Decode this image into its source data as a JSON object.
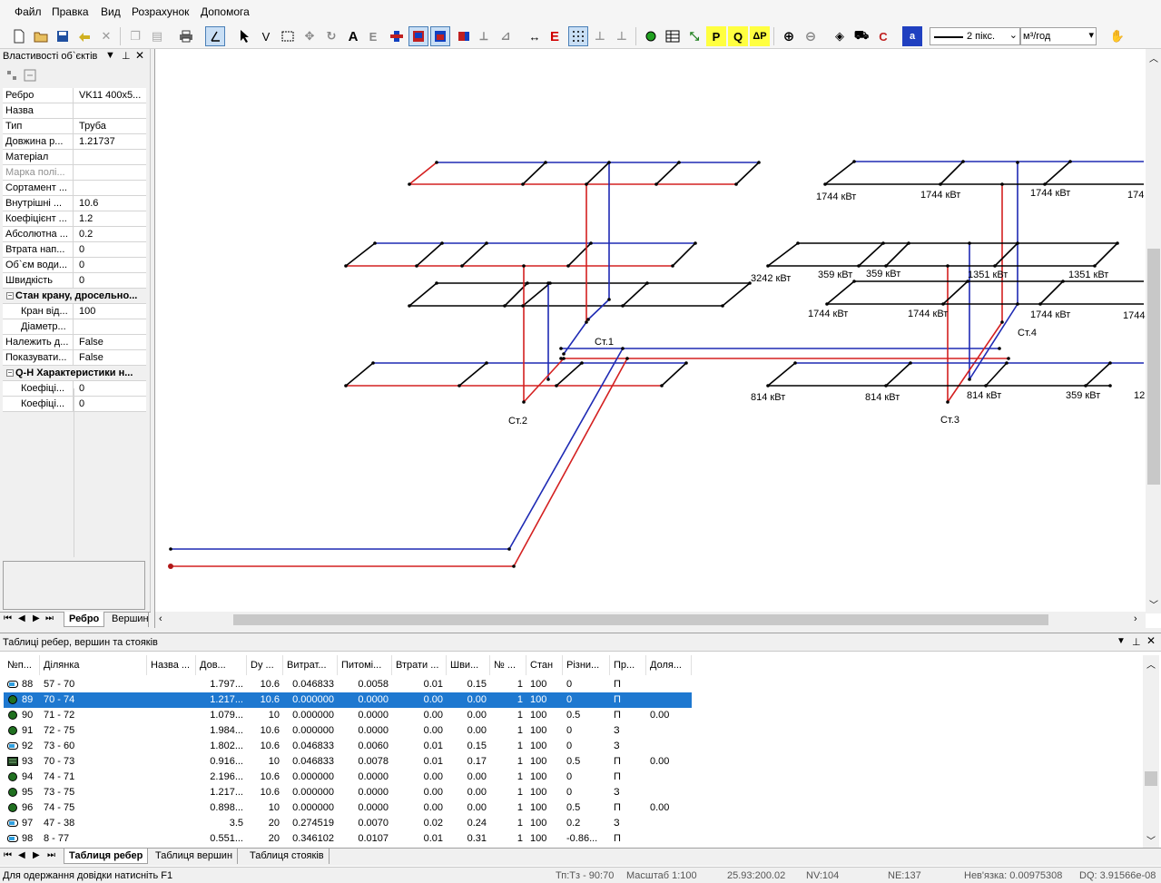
{
  "menu": [
    "Файл",
    "Правка",
    "Вид",
    "Розрахунок",
    "Допомога"
  ],
  "toolbar": {
    "line_width": "2 пікс.",
    "units": "м³/год",
    "icons": [
      "new-icon",
      "open-icon",
      "save-icon",
      "undo-icon",
      "delete-icon",
      "copy-icon",
      "paste-icon",
      "print-icon",
      "angle-icon",
      "pointer-icon",
      "vertex-icon",
      "rect-select-icon",
      "move-icon",
      "rotate-icon",
      "text-icon",
      "text-e-icon",
      "node-icon",
      "node-red-icon",
      "node-blue-icon",
      "node-flag-icon",
      "measure-icon",
      "tilt-icon",
      "dimension-icon",
      "e-icon",
      "grid-icon",
      "sep",
      "sep",
      "green-dot-icon",
      "table-icon",
      "link-icon",
      "p-icon",
      "q-icon",
      "ap-icon",
      "zoom-in-icon",
      "zoom-out-icon",
      "pan-icon",
      "truck-icon",
      "c-icon",
      "a-icon"
    ]
  },
  "properties": {
    "title": "Властивості об`єктів",
    "rows": [
      {
        "k": "Ребро",
        "v": "VK11 400x5..."
      },
      {
        "k": "Назва",
        "v": ""
      },
      {
        "k": "Тип",
        "v": "Труба"
      },
      {
        "k": "Довжина р...",
        "v": "1.21737"
      },
      {
        "k": "Матеріал",
        "v": ""
      },
      {
        "k": "Марка полі...",
        "v": "",
        "disabled": true
      },
      {
        "k": "Сортамент ...",
        "v": ""
      },
      {
        "k": "Внутрішні ...",
        "v": "10.6"
      },
      {
        "k": "Коефіцієнт ...",
        "v": "1.2"
      },
      {
        "k": "Абсолютна ...",
        "v": "0.2"
      },
      {
        "k": "Втрата нап...",
        "v": "0"
      },
      {
        "k": "Об`єм води...",
        "v": "0"
      },
      {
        "k": "Швидкість",
        "v": "0"
      },
      {
        "k": "Стан крану, дросельно...",
        "v": "",
        "group": true
      },
      {
        "k": "Кран від...",
        "v": "100",
        "sub": true
      },
      {
        "k": "Діаметр...",
        "v": "",
        "sub": true
      },
      {
        "k": "Належить д...",
        "v": "False"
      },
      {
        "k": "Показувати...",
        "v": "False"
      },
      {
        "k": "Q-H Характеристики н...",
        "v": "",
        "group": true
      },
      {
        "k": "Коефіці...",
        "v": "0",
        "sub": true
      },
      {
        "k": "Коефіці...",
        "v": "0",
        "sub": true
      }
    ],
    "tabs": [
      "Ребро",
      "Вершин"
    ]
  },
  "canvas": {
    "labels": [
      {
        "t": "1744 кВт"
      },
      {
        "t": "1744 кВт"
      },
      {
        "t": "1744 кВт"
      },
      {
        "t": "174"
      },
      {
        "t": "3242 кВт"
      },
      {
        "t": "359 кВт"
      },
      {
        "t": "359 кВт"
      },
      {
        "t": "1351 кВт"
      },
      {
        "t": "1351 кВт"
      },
      {
        "t": "1744 кВт"
      },
      {
        "t": "1744 кВт"
      },
      {
        "t": "1744 кВт"
      },
      {
        "t": "1744"
      },
      {
        "t": "Ст.1"
      },
      {
        "t": "Ст.4"
      },
      {
        "t": "814 кВт"
      },
      {
        "t": "814 кВт"
      },
      {
        "t": "814 кВт"
      },
      {
        "t": "359 кВт"
      },
      {
        "t": "12"
      },
      {
        "t": "Ст.2"
      },
      {
        "t": "Ст.3"
      }
    ]
  },
  "table": {
    "title": "Таблиці ребер, вершин та стояків",
    "headers": [
      "№п...",
      "Ділянка",
      "Назва ...",
      "Дов...",
      "Dy ...",
      "Витрат...",
      "Питомі...",
      "Втрати ...",
      "Шви...",
      "№ ...",
      "Стан",
      "Різни...",
      "Пр...",
      "Доля..."
    ],
    "rows": [
      {
        "icon": "pipe-blue",
        "n": "88",
        "seg": "57 - 70",
        "name": "",
        "len": "1.797...",
        "dy": "10.6",
        "flow": "0.046833",
        "spec": "0.0058",
        "loss": "0.01",
        "speed": "0.15",
        "num": "1",
        "state": "100",
        "diff": "0",
        "pr": "П",
        "share": ""
      },
      {
        "icon": "valve-green",
        "n": "89",
        "seg": "70 - 74",
        "name": "",
        "len": "1.217...",
        "dy": "10.6",
        "flow": "0.000000",
        "spec": "0.0000",
        "loss": "0.00",
        "speed": "0.00",
        "num": "1",
        "state": "100",
        "diff": "0",
        "pr": "П",
        "share": "",
        "selected": true
      },
      {
        "icon": "valve-green",
        "n": "90",
        "seg": "71 - 72",
        "name": "",
        "len": "1.079...",
        "dy": "10",
        "flow": "0.000000",
        "spec": "0.0000",
        "loss": "0.00",
        "speed": "0.00",
        "num": "1",
        "state": "100",
        "diff": "0.5",
        "pr": "П",
        "share": "0.00"
      },
      {
        "icon": "valve-green",
        "n": "91",
        "seg": "72 - 75",
        "name": "",
        "len": "1.984...",
        "dy": "10.6",
        "flow": "0.000000",
        "spec": "0.0000",
        "loss": "0.00",
        "speed": "0.00",
        "num": "1",
        "state": "100",
        "diff": "0",
        "pr": "З",
        "share": ""
      },
      {
        "icon": "pipe-blue",
        "n": "92",
        "seg": "73 - 60",
        "name": "",
        "len": "1.802...",
        "dy": "10.6",
        "flow": "0.046833",
        "spec": "0.0060",
        "loss": "0.01",
        "speed": "0.15",
        "num": "1",
        "state": "100",
        "diff": "0",
        "pr": "З",
        "share": ""
      },
      {
        "icon": "device-dark",
        "n": "93",
        "seg": "70 - 73",
        "name": "",
        "len": "0.916...",
        "dy": "10",
        "flow": "0.046833",
        "spec": "0.0078",
        "loss": "0.01",
        "speed": "0.17",
        "num": "1",
        "state": "100",
        "diff": "0.5",
        "pr": "П",
        "share": "0.00"
      },
      {
        "icon": "valve-green",
        "n": "94",
        "seg": "74 - 71",
        "name": "",
        "len": "2.196...",
        "dy": "10.6",
        "flow": "0.000000",
        "spec": "0.0000",
        "loss": "0.00",
        "speed": "0.00",
        "num": "1",
        "state": "100",
        "diff": "0",
        "pr": "П",
        "share": ""
      },
      {
        "icon": "valve-green",
        "n": "95",
        "seg": "73 - 75",
        "name": "",
        "len": "1.217...",
        "dy": "10.6",
        "flow": "0.000000",
        "spec": "0.0000",
        "loss": "0.00",
        "speed": "0.00",
        "num": "1",
        "state": "100",
        "diff": "0",
        "pr": "З",
        "share": ""
      },
      {
        "icon": "valve-green",
        "n": "96",
        "seg": "74 - 75",
        "name": "",
        "len": "0.898...",
        "dy": "10",
        "flow": "0.000000",
        "spec": "0.0000",
        "loss": "0.00",
        "speed": "0.00",
        "num": "1",
        "state": "100",
        "diff": "0.5",
        "pr": "П",
        "share": "0.00"
      },
      {
        "icon": "pipe-blue",
        "n": "97",
        "seg": "47 - 38",
        "name": "",
        "len": "3.5",
        "dy": "20",
        "flow": "0.274519",
        "spec": "0.0070",
        "loss": "0.02",
        "speed": "0.24",
        "num": "1",
        "state": "100",
        "diff": "0.2",
        "pr": "З",
        "share": ""
      },
      {
        "icon": "pipe-blue",
        "n": "98",
        "seg": "8 - 77",
        "name": "",
        "len": "0.551...",
        "dy": "20",
        "flow": "0.346102",
        "spec": "0.0107",
        "loss": "0.01",
        "speed": "0.31",
        "num": "1",
        "state": "100",
        "diff": "-0.86...",
        "pr": "П",
        "share": ""
      }
    ],
    "tabs": [
      "Таблиця ребер",
      "Таблиця вершин",
      "Таблиця стояків"
    ]
  },
  "status": {
    "help": "Для одержання довідки натисніть F1",
    "tp": "Тп:Тз - 90:70",
    "scale": "Масштаб 1:100",
    "coords": "25.93:200.02",
    "nv": "NV:104",
    "ne": "NE:137",
    "nev": "Нев'язка: 0.00975308",
    "dq": "DQ: 3.91566e-08"
  }
}
